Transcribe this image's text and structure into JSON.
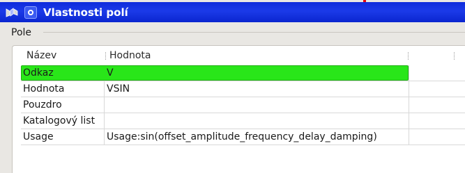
{
  "window": {
    "title": "Vlastnosti polí"
  },
  "group": {
    "label": "Pole"
  },
  "table": {
    "headers": [
      "Název",
      "Hodnota"
    ],
    "rows": [
      {
        "name": "Odkaz",
        "value": "V",
        "selected": true
      },
      {
        "name": "Hodnota",
        "value": "VSIN",
        "selected": false
      },
      {
        "name": "Pouzdro",
        "value": "",
        "selected": false
      },
      {
        "name": "Katalogový list",
        "value": "",
        "selected": false
      },
      {
        "name": "Usage",
        "value": "Usage:sin(offset_amplitude_frequency_delay_damping)",
        "selected": false
      }
    ]
  },
  "colors": {
    "titlebar": "#1b3ae8",
    "selection": "#29e619",
    "window_bg": "#e9e7e3"
  },
  "icons": {
    "app": "kicad-app-icon",
    "window_menu": "window-menu-icon"
  }
}
